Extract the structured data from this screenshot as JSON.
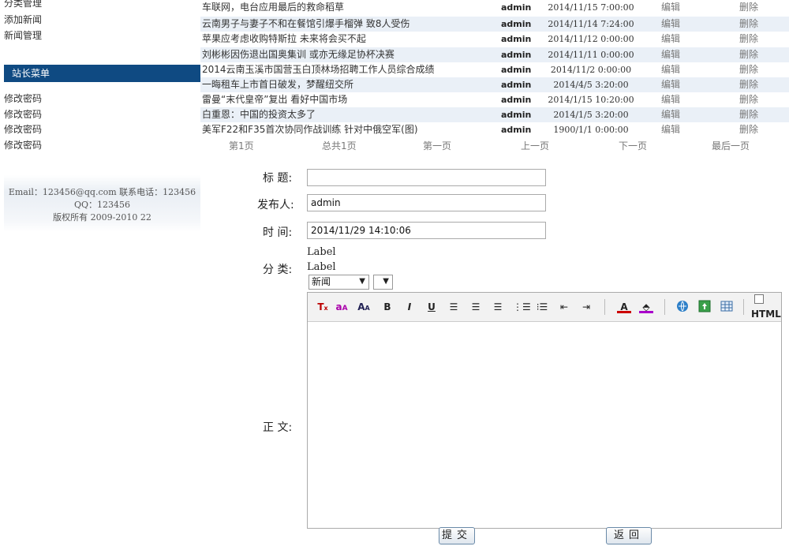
{
  "sidebar": {
    "top_links": [
      "分类管理",
      "添加新闻",
      "新闻管理"
    ],
    "menu_title": "站长菜单",
    "menu_links": [
      "修改密码",
      "修改密码",
      "修改密码",
      "修改密码"
    ],
    "footer": {
      "line1": "Email：123456@qq.com 联系电话：123456",
      "line2": "QQ：123456",
      "line3": "版权所有 2009-2010 22"
    }
  },
  "news": {
    "rows": [
      {
        "title": "车联网，电台应用最后的救命稻草",
        "author": "admin",
        "date": "2014/11/15 7:00:00",
        "edit": "编辑",
        "delete": "删除"
      },
      {
        "title": "云南男子与妻子不和在餐馆引爆手榴弹 致8人受伤",
        "author": "admin",
        "date": "2014/11/14 7:24:00",
        "edit": "编辑",
        "delete": "删除"
      },
      {
        "title": "苹果应考虑收购特斯拉 未来将会买不起",
        "author": "admin",
        "date": "2014/11/12 0:00:00",
        "edit": "编辑",
        "delete": "删除"
      },
      {
        "title": "刘彬彬因伤退出国奥集训 或亦无缘足协杯决赛",
        "author": "admin",
        "date": "2014/11/11 0:00:00",
        "edit": "编辑",
        "delete": "删除"
      },
      {
        "title": "2014云南玉溪市国营玉白顶林场招聘工作人员综合成绩",
        "author": "admin",
        "date": "2014/11/2 0:00:00",
        "edit": "编辑",
        "delete": "删除"
      },
      {
        "title": "一晦租车上市首日破发，梦醒纽交所",
        "author": "admin",
        "date": "2014/4/5 3:20:00",
        "edit": "编辑",
        "delete": "删除"
      },
      {
        "title": "雷曼“末代皇帝”复出 看好中国市场",
        "author": "admin",
        "date": "2014/1/15 10:20:00",
        "edit": "编辑",
        "delete": "删除"
      },
      {
        "title": "白重恩：中国的投资太多了",
        "author": "admin",
        "date": "2014/1/5 3:20:00",
        "edit": "编辑",
        "delete": "删除"
      },
      {
        "title": "美军F22和F35首次协同作战训练 针对中俄空军(图)",
        "author": "admin",
        "date": "1900/1/1 0:00:00",
        "edit": "编辑",
        "delete": "删除"
      }
    ],
    "pager": {
      "page": "第1页",
      "total": "总共1页",
      "first": "第一页",
      "prev": "上一页",
      "next": "下一页",
      "last": "最后一页"
    }
  },
  "form": {
    "title_label": "标 题:",
    "title_value": "",
    "publisher_label": "发布人:",
    "publisher_value": "admin",
    "time_label": "时 间:",
    "time_value": "2014/11/29 14:10:06",
    "category_label": "分 类:",
    "label1": "Label",
    "label2": "Label",
    "category_select": "新闻",
    "sub_select": "",
    "body_label": "正 文:",
    "html_label": "HTML",
    "submit": "提交",
    "back": "返回"
  }
}
